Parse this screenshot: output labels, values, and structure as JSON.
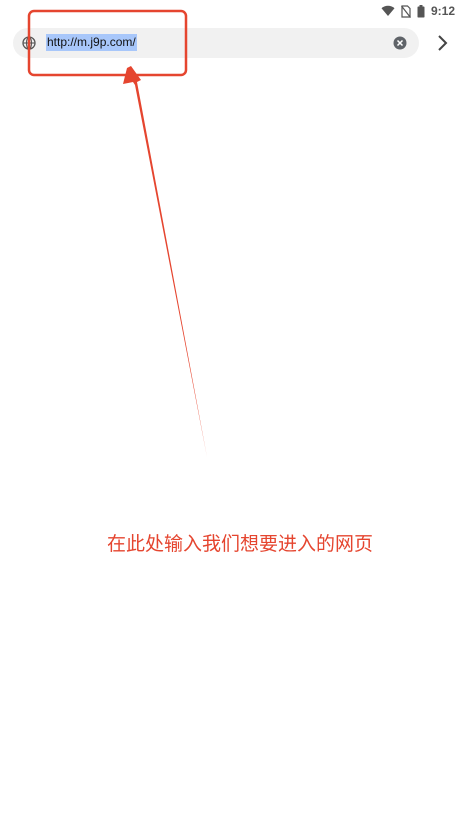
{
  "status_bar": {
    "time": "9:12",
    "icons": [
      "wifi-icon",
      "no-sim-icon",
      "battery-icon"
    ]
  },
  "address_bar": {
    "url": "http://m.j9p.com/",
    "url_selected": true,
    "left_icon": "globe-icon",
    "clear_icon": "clear-icon",
    "go_icon": "chevron-right-icon"
  },
  "annotation": {
    "text": "在此处输入我们想要进入的网页",
    "color": "#e5452f"
  }
}
